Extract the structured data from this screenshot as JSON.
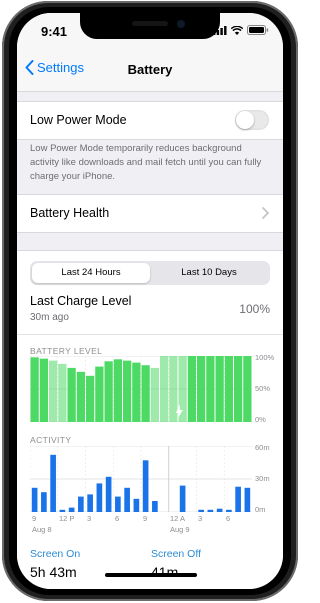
{
  "status_bar": {
    "time": "9:41"
  },
  "nav": {
    "back_label": "Settings",
    "title": "Battery"
  },
  "low_power": {
    "label": "Low Power Mode",
    "enabled": false,
    "footnote": "Low Power Mode temporarily reduces background activity like downloads and mail fetch until you can fully charge your iPhone."
  },
  "battery_health": {
    "label": "Battery Health"
  },
  "segmented": {
    "options": [
      "Last 24 Hours",
      "Last 10 Days"
    ],
    "selected": 0
  },
  "last_charge": {
    "label": "Last Charge Level",
    "sub": "30m ago",
    "value": "100%"
  },
  "battery_chart": {
    "title": "BATTERY LEVEL",
    "y_ticks": [
      "100%",
      "50%",
      "0%"
    ]
  },
  "activity_chart": {
    "title": "ACTIVITY",
    "y_ticks": [
      "60m",
      "30m",
      "0m"
    ],
    "x_ticks": [
      "9",
      "12 P",
      "3",
      "6",
      "9",
      "12 A",
      "3",
      "6"
    ],
    "date_labels": [
      "Aug 8",
      "Aug 9"
    ]
  },
  "chart_data": [
    {
      "type": "area",
      "title": "BATTERY LEVEL",
      "ylim": [
        0,
        100
      ],
      "y_ticks": [
        "0%",
        "50%",
        "100%"
      ],
      "x": [
        "9",
        "10",
        "11",
        "12 P",
        "1",
        "2",
        "3",
        "4",
        "5",
        "6",
        "7",
        "8",
        "9",
        "10",
        "11",
        "12 A",
        "1",
        "2",
        "3",
        "4",
        "5",
        "6",
        "7",
        "8"
      ],
      "values": [
        98,
        96,
        93,
        88,
        82,
        76,
        70,
        84,
        92,
        95,
        93,
        90,
        86,
        82,
        100,
        100,
        100,
        100,
        100,
        100,
        100,
        100,
        100,
        100
      ],
      "charging_segments": [
        [
          2,
          3
        ],
        [
          13,
          16
        ]
      ],
      "color": "#4cd964"
    },
    {
      "type": "bar",
      "title": "ACTIVITY",
      "ylim": [
        0,
        60
      ],
      "y_ticks": [
        "0m",
        "30m",
        "60m"
      ],
      "x": [
        "9",
        "10",
        "11",
        "12 P",
        "1",
        "2",
        "3",
        "4",
        "5",
        "6",
        "7",
        "8",
        "9",
        "10",
        "11",
        "12 A",
        "1",
        "2",
        "3",
        "4",
        "5",
        "6",
        "7",
        "8"
      ],
      "values": [
        22,
        18,
        52,
        2,
        4,
        14,
        16,
        26,
        32,
        14,
        22,
        12,
        47,
        10,
        0,
        0,
        24,
        0,
        2,
        2,
        3,
        2,
        23,
        22
      ],
      "color": "#1a73e8"
    }
  ],
  "screen_on": {
    "label": "Screen On",
    "value": "5h 43m"
  },
  "screen_off": {
    "label": "Screen Off",
    "value": "41m"
  }
}
